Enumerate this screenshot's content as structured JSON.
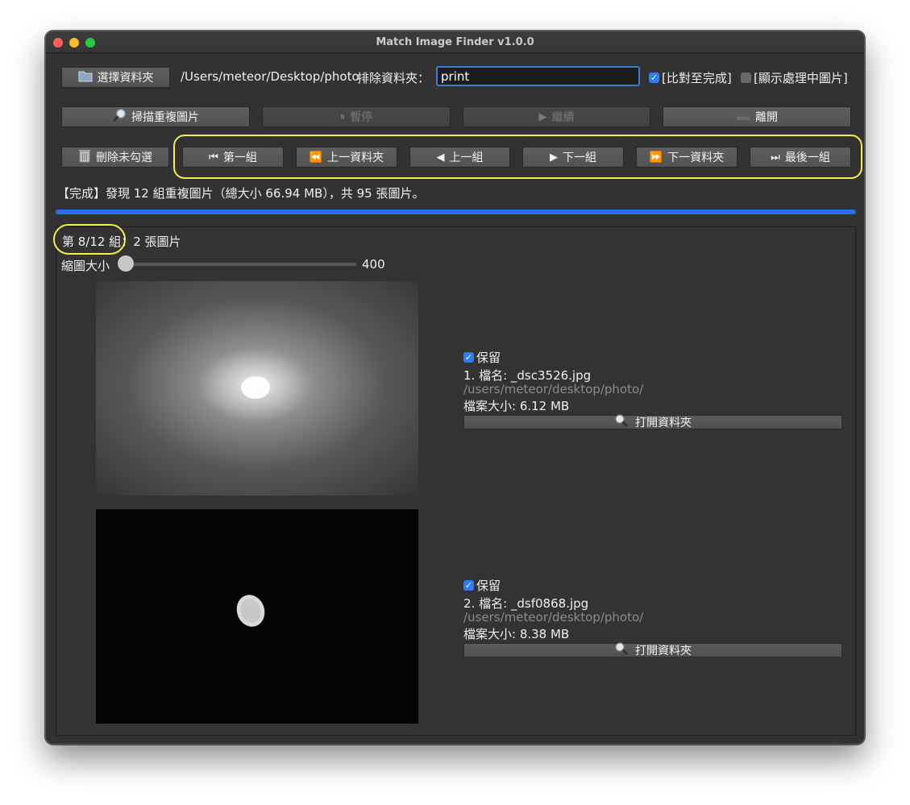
{
  "window": {
    "title": "Match Image Finder v1.0.0"
  },
  "toolbar": {
    "choose_folder_label": "選擇資料夾",
    "folder_path": "/Users/meteor/Desktop/photo",
    "exclude_label": "排除資料夾：",
    "exclude_value": "print",
    "compare_to_end_label": "[比對至完成]",
    "compare_to_end_checked": true,
    "show_processing_label": "[顯示處理中圖片]",
    "show_processing_checked": false
  },
  "actions": {
    "scan_label": "掃描重複圖片",
    "pause_label": "暫停",
    "resume_label": "繼續",
    "quit_label": "離開"
  },
  "nav": {
    "delete_unchecked_label": "刪除未勾選",
    "first_group": "第一組",
    "prev_folder": "上一資料夾",
    "prev_group": "上一組",
    "next_group": "下一組",
    "next_folder": "下一資料夾",
    "last_group": "最後一組"
  },
  "status": {
    "message": "【完成】發現 12 組重複圖片（總大小 66.94 MB），共 95 張圖片。",
    "progress_percent": 100
  },
  "group": {
    "header_prefix": "第 8/12 組",
    "header_suffix": "：2 張圖片",
    "thumb_size_label": "縮圖大小",
    "thumb_size_value": "400"
  },
  "images": [
    {
      "keep_label": "保留",
      "keep_checked": true,
      "name_line": "1. 檔名: _dsc3526.jpg",
      "path": "/users/meteor/desktop/photo/",
      "size_line": "檔案大小: 6.12 MB",
      "open_label": "打開資料夾"
    },
    {
      "keep_label": "保留",
      "keep_checked": true,
      "name_line": "2. 檔名: _dsf0868.jpg",
      "path": "/users/meteor/desktop/photo/",
      "size_line": "檔案大小: 8.38 MB",
      "open_label": "打開資料夾"
    }
  ],
  "colors": {
    "accent": "#2f7df6",
    "highlight": "#f5ef4a",
    "window_bg": "#323232"
  }
}
